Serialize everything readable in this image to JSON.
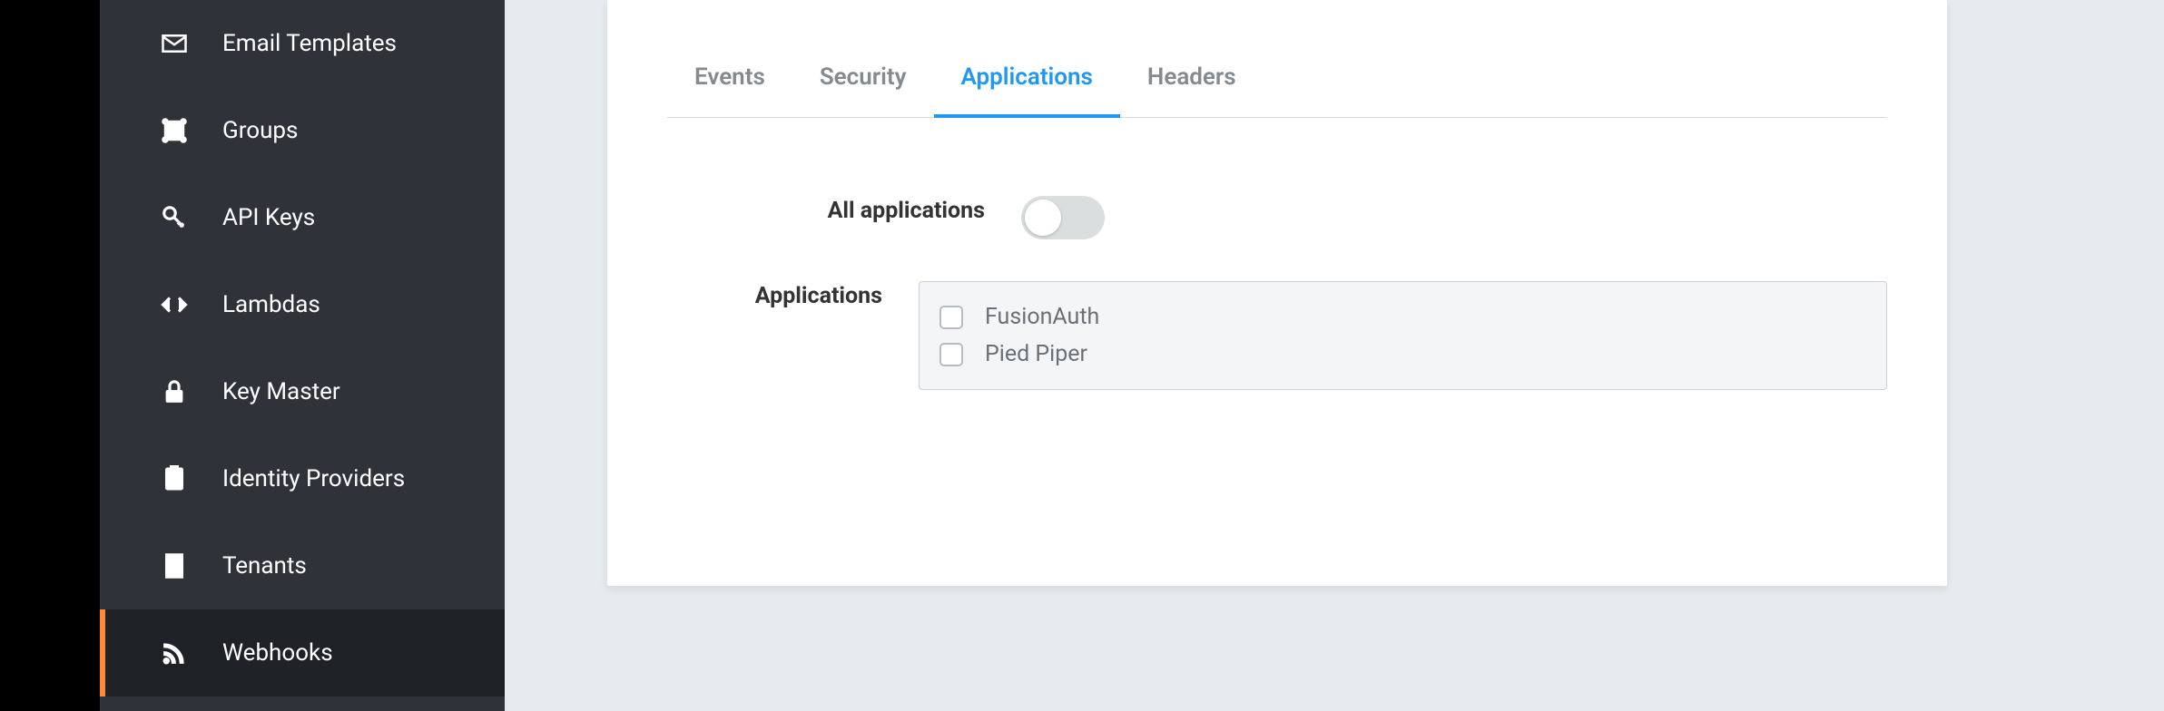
{
  "sidebar": {
    "items": [
      {
        "label": "Email Templates",
        "icon": "envelope-icon"
      },
      {
        "label": "Groups",
        "icon": "group-icon"
      },
      {
        "label": "API Keys",
        "icon": "key-icon"
      },
      {
        "label": "Lambdas",
        "icon": "code-icon"
      },
      {
        "label": "Key Master",
        "icon": "lock-icon"
      },
      {
        "label": "Identity Providers",
        "icon": "id-card-icon"
      },
      {
        "label": "Tenants",
        "icon": "building-icon"
      },
      {
        "label": "Webhooks",
        "icon": "rss-icon"
      }
    ],
    "active_index": 7
  },
  "tabs": {
    "items": [
      {
        "label": "Events"
      },
      {
        "label": "Security"
      },
      {
        "label": "Applications"
      },
      {
        "label": "Headers"
      }
    ],
    "active_index": 2
  },
  "form": {
    "all_applications_label": "All applications",
    "all_applications_on": false,
    "applications_label": "Applications",
    "applications": [
      {
        "name": "FusionAuth",
        "checked": false
      },
      {
        "name": "Pied Piper",
        "checked": false
      }
    ]
  }
}
